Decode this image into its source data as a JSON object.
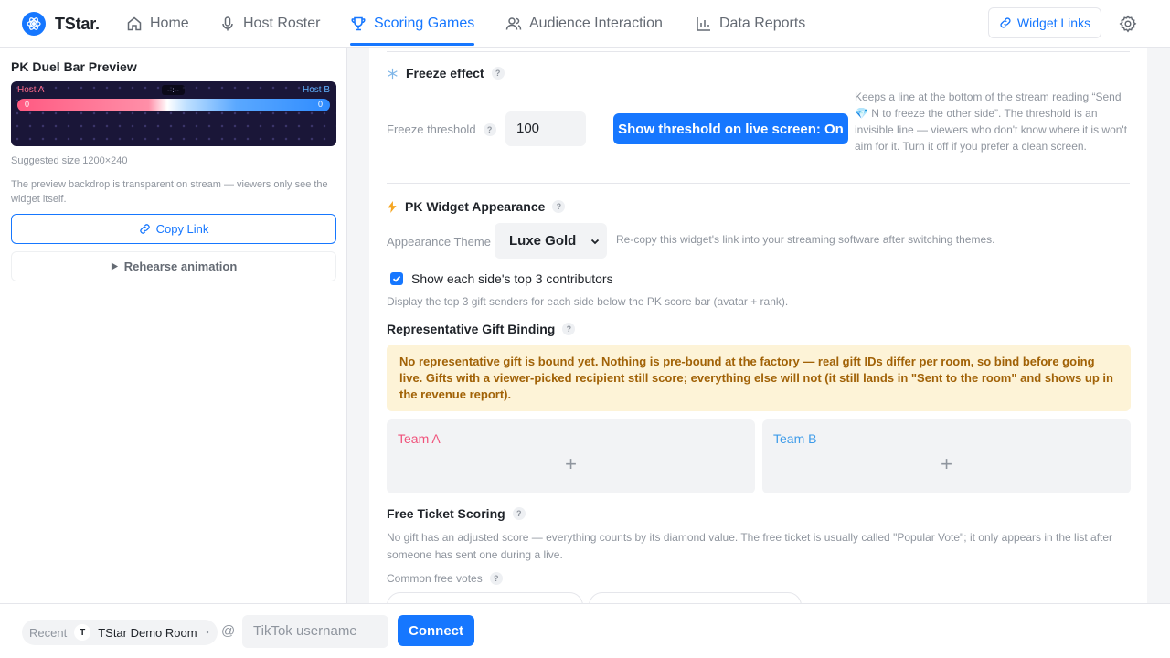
{
  "brand": {
    "name": "TStar."
  },
  "nav": {
    "items": [
      {
        "label": "Home",
        "icon": "home-icon"
      },
      {
        "label": "Host Roster",
        "icon": "microphone-icon"
      },
      {
        "label": "Scoring Games",
        "icon": "trophy-icon",
        "active": true
      },
      {
        "label": "Audience Interaction",
        "icon": "users-icon"
      },
      {
        "label": "Data Reports",
        "icon": "bar-chart-icon"
      }
    ],
    "widget_links": "Widget Links"
  },
  "left": {
    "title": "PK Duel Bar Preview",
    "preview": {
      "host_a": "Host A",
      "host_b": "Host B",
      "timer": "--:--",
      "score_a": "0",
      "score_b": "0"
    },
    "size_note": "Suggested size 1200×240",
    "backdrop_note": "The preview backdrop is transparent on stream — viewers only see the widget itself.",
    "copy_link": "Copy Link",
    "rehearse": "Rehearse animation"
  },
  "freeze": {
    "title": "Freeze effect",
    "threshold_label": "Freeze threshold",
    "threshold_value": "100",
    "show_button": "Show threshold on live screen: On",
    "desc": "Keeps a line at the bottom of the stream reading “Send 💎 N to freeze the other side”. The threshold is an invisible line — viewers who don't know where it is won't aim for it. Turn it off if you prefer a clean screen."
  },
  "appearance": {
    "title": "PK Widget Appearance",
    "theme_label": "Appearance Theme",
    "theme_value": "Luxe Gold",
    "theme_note": "Re-copy this widget's link into your streaming software after switching themes.",
    "top3_label": "Show each side's top 3 contributors",
    "top3_checked": true,
    "top3_desc": "Display the top 3 gift senders for each side below the PK score bar (avatar + rank)."
  },
  "gift_binding": {
    "title": "Representative Gift Binding",
    "warning": "No representative gift is bound yet. Nothing is pre-bound at the factory — real gift IDs differ per room, so bind before going live. Gifts with a viewer-picked recipient still score; everything else will not (it still lands in \"Sent to the room\" and shows up in the revenue report).",
    "team_a": "Team A",
    "team_b": "Team B",
    "add": "+"
  },
  "free_ticket": {
    "title": "Free Ticket Scoring",
    "desc": "No gift has an adjusted score — everything counts by its diamond value. The free ticket is usually called \"Popular Vote\"; it only appears in the list after someone has sent one during a live.",
    "common_label": "Common free votes"
  },
  "bottom": {
    "recent_label": "Recent",
    "room_initial": "T",
    "room_name": "TStar Demo Room",
    "at": "@",
    "username_placeholder": "TikTok username",
    "connect": "Connect"
  },
  "colors": {
    "accent": "#1677ff",
    "team_a": "#f0517a",
    "team_b": "#3d9be9",
    "warning_bg": "#fdf3d7",
    "warning_text": "#a16207"
  }
}
